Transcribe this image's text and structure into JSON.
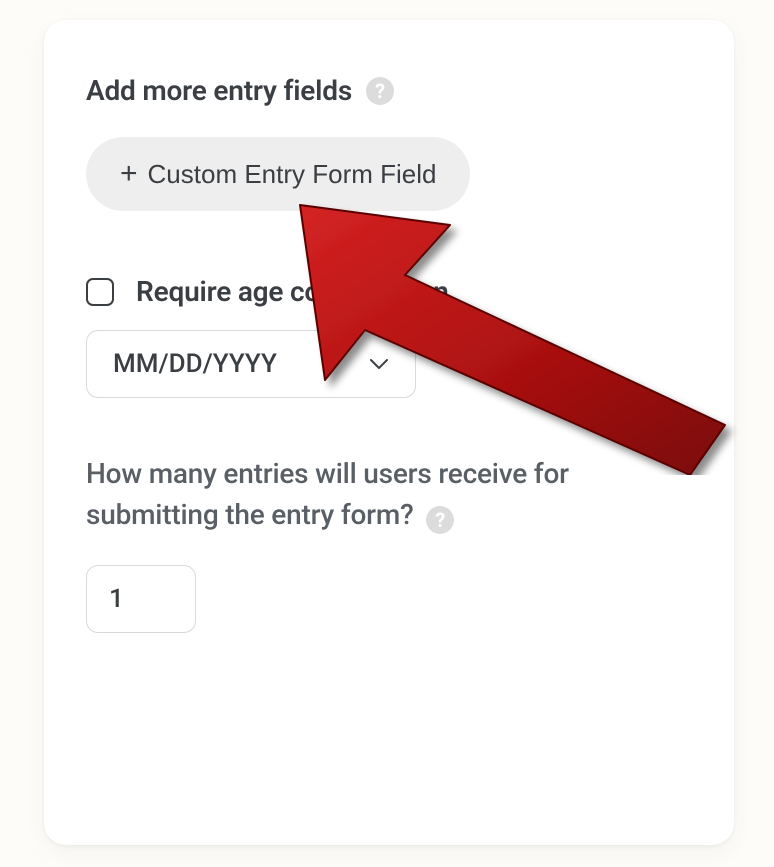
{
  "header": {
    "title": "Add more entry fields"
  },
  "add_button": {
    "label": "Custom Entry Form Field"
  },
  "age_confirm": {
    "label": "Require age confirmation",
    "date_format": "MM/DD/YYYY"
  },
  "entries": {
    "question": "How many entries will users receive for submitting the entry form?",
    "value": "1"
  }
}
